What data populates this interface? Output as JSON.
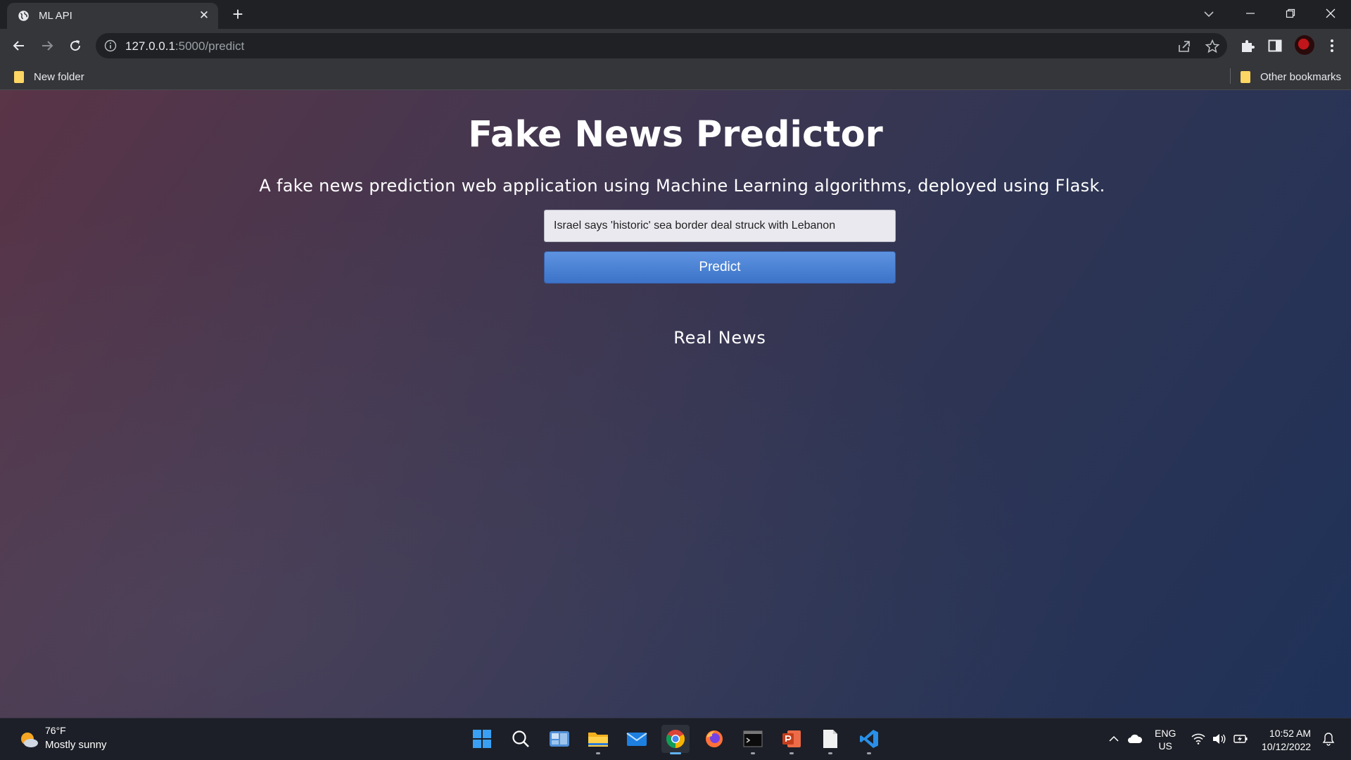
{
  "browser": {
    "tab_title": "ML API",
    "url_host": "127.0.0.1",
    "url_path": ":5000/predict",
    "bookmarks": [
      "New folder"
    ],
    "other_bookmarks": "Other bookmarks"
  },
  "page": {
    "title": "Fake News Predictor",
    "subtitle": "A fake news prediction web application using Machine Learning algorithms, deployed using Flask.",
    "input_value": "Israel says 'historic' sea border deal struck with Lebanon",
    "predict_label": "Predict",
    "result": "Real News"
  },
  "taskbar": {
    "weather_temp": "76°F",
    "weather_desc": "Mostly sunny",
    "apps": [
      "start-icon",
      "search-icon",
      "widgets-icon",
      "file-explorer-icon",
      "mail-icon",
      "chrome-icon",
      "firefox-icon",
      "terminal-icon",
      "powerpoint-icon",
      "notepad-icon",
      "vscode-icon"
    ],
    "lang_line1": "ENG",
    "lang_line2": "US",
    "time": "10:52 AM",
    "date": "10/12/2022"
  },
  "colors": {
    "accent_button": "#4a80d4",
    "chrome_bg": "#35363a",
    "tabstrip_bg": "#202124",
    "taskbar_bg": "#1c1f27"
  }
}
